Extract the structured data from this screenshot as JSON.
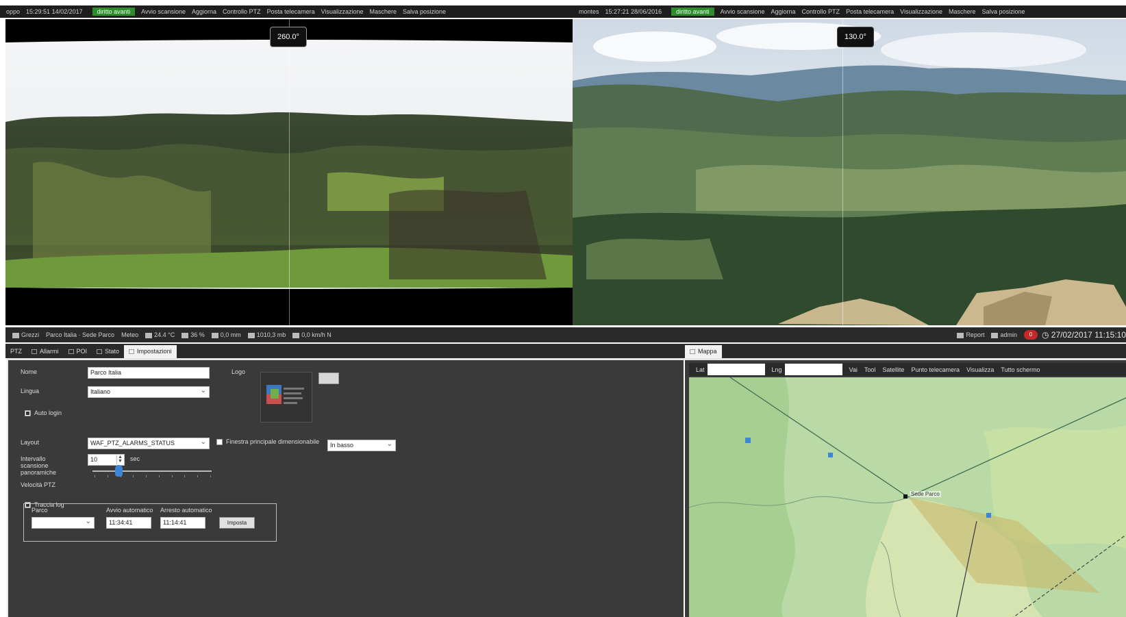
{
  "left_camera": {
    "bar_name": "oppo",
    "timestamp": "15:29:51 14/02/2017",
    "status_badge": "diritto avanti",
    "menu": [
      "Avvio scansione",
      "Aggiorna",
      "Controllo PTZ",
      "Posta telecamera",
      "Visualizzazione",
      "Maschere",
      "Salva posizione"
    ],
    "angle": "260.0°"
  },
  "right_camera": {
    "bar_name": "montes",
    "timestamp": "15:27:21 28/06/2016",
    "status_badge": "diritto avanti",
    "menu": [
      "Avvio scansione",
      "Aggiorna",
      "Controllo PTZ",
      "Posta telecamera",
      "Visualizzazione",
      "Maschere",
      "Salva posizione"
    ],
    "angle": "130.0°"
  },
  "status_strip": {
    "site_tab": "Grezzi",
    "site_name": "Parco Italia · Sede Parco",
    "weather_label": "Meteo",
    "temperature": "24.4 °C",
    "humidity": "36 %",
    "rain": "0,0 mm",
    "pressure": "1010,3 mb",
    "wind": "0,0 km/h N",
    "report_label": "Report",
    "user": "admin",
    "alert_count": "0",
    "datetime": "27/02/2017 11:15:10"
  },
  "left_tabs": [
    {
      "label": "PTZ",
      "active": false
    },
    {
      "label": "Allarmi",
      "active": false
    },
    {
      "label": "POI",
      "active": false
    },
    {
      "label": "Stato",
      "active": false
    },
    {
      "label": "Impostazioni",
      "active": true
    }
  ],
  "right_tabs": [
    {
      "label": "Mappa",
      "active": true
    }
  ],
  "settings": {
    "name_label": "Nome",
    "name_value": "Parco Italia",
    "language_label": "Lingua",
    "language_value": "Italiano",
    "logo_label": "Logo",
    "autologin_label": "Auto login",
    "layout_label": "Layout",
    "layout_value": "WAF_PTZ_ALARMS_STATUS",
    "main_window_label": "Finestra principale dimensionabile",
    "main_window_value": "In basso",
    "interval_label": "Intervallo scansione panoramiche",
    "interval_value": "10",
    "interval_unit": "sec",
    "ptz_speed_label": "Velocità PTZ",
    "ptz_speed_level": 0.22,
    "trace_log_label": "Traccia log",
    "group": {
      "park_label": "Parco",
      "park_value": "",
      "auto_start_label": "Avvio automatico",
      "auto_start_value": "11:34:41",
      "auto_stop_label": "Arresto automatico",
      "auto_stop_value": "11:14:41",
      "set_button": "Imposta"
    }
  },
  "map": {
    "lat_label": "Lat",
    "lng_label": "Lng",
    "menu": [
      "Vai",
      "Tool",
      "Satellite",
      "Punto telecamera",
      "Visualizza",
      "Tutto schermo"
    ],
    "camera_label": "Sede Parco"
  },
  "colors": {
    "accent_green": "#2e8b2e",
    "alert_red": "#c62828",
    "slider_blue": "#3b86d8"
  }
}
